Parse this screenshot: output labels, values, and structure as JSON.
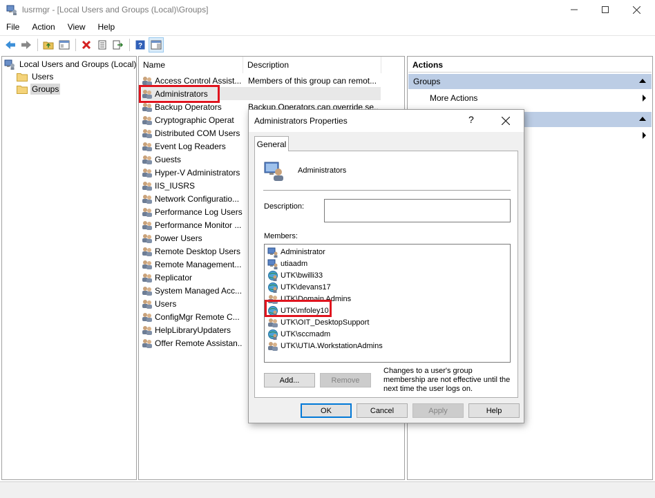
{
  "window": {
    "title": "lusrmgr - [Local Users and Groups (Local)\\Groups]"
  },
  "menu": [
    "File",
    "Action",
    "View",
    "Help"
  ],
  "tree": {
    "root": "Local Users and Groups (Local)",
    "children": [
      "Users",
      "Groups"
    ]
  },
  "list": {
    "columns": [
      "Name",
      "Description"
    ],
    "rows": [
      {
        "name": "Access Control Assist...",
        "desc": "Members of this group can remot..."
      },
      {
        "name": "Administrators",
        "desc": ""
      },
      {
        "name": "Backup Operators",
        "desc": "Backup Operators can override se..."
      },
      {
        "name": "Cryptographic Operat",
        "desc": ""
      },
      {
        "name": "Distributed COM Users",
        "desc": ""
      },
      {
        "name": "Event Log Readers",
        "desc": ""
      },
      {
        "name": "Guests",
        "desc": ""
      },
      {
        "name": "Hyper-V Administrators",
        "desc": ""
      },
      {
        "name": "IIS_IUSRS",
        "desc": ""
      },
      {
        "name": "Network Configuratio...",
        "desc": ""
      },
      {
        "name": "Performance Log Users",
        "desc": ""
      },
      {
        "name": "Performance Monitor ...",
        "desc": ""
      },
      {
        "name": "Power Users",
        "desc": ""
      },
      {
        "name": "Remote Desktop Users",
        "desc": ""
      },
      {
        "name": "Remote Management...",
        "desc": ""
      },
      {
        "name": "Replicator",
        "desc": ""
      },
      {
        "name": "System Managed Acc...",
        "desc": ""
      },
      {
        "name": "Users",
        "desc": ""
      },
      {
        "name": "ConfigMgr Remote C...",
        "desc": ""
      },
      {
        "name": "HelpLibraryUpdaters",
        "desc": ""
      },
      {
        "name": "Offer Remote Assistan...",
        "desc": ""
      }
    ]
  },
  "actions": {
    "title": "Actions",
    "section1": "Groups",
    "more_actions": "More Actions"
  },
  "dialog": {
    "title": "Administrators Properties",
    "help": "?",
    "tab": "General",
    "group_name": "Administrators",
    "description_label": "Description:",
    "members_label": "Members:",
    "members": [
      {
        "name": "Administrator",
        "type": "user"
      },
      {
        "name": "utiaadm",
        "type": "user"
      },
      {
        "name": "UTK\\bwilli33",
        "type": "domain-user"
      },
      {
        "name": "UTK\\devans17",
        "type": "domain-user"
      },
      {
        "name": "UTK\\Domain Admins",
        "type": "domain-group"
      },
      {
        "name": "UTK\\mfoley10",
        "type": "domain-user"
      },
      {
        "name": "UTK\\OIT_DesktopSupport",
        "type": "domain-group"
      },
      {
        "name": "UTK\\sccmadm",
        "type": "domain-user"
      },
      {
        "name": "UTK\\UTIA.WorkstationAdmins",
        "type": "domain-group"
      }
    ],
    "add_label": "Add...",
    "remove_label": "Remove",
    "note": "Changes to a user's group membership are not effective until the next time the user logs on.",
    "ok_label": "OK",
    "cancel_label": "Cancel",
    "apply_label": "Apply",
    "help_label": "Help"
  }
}
